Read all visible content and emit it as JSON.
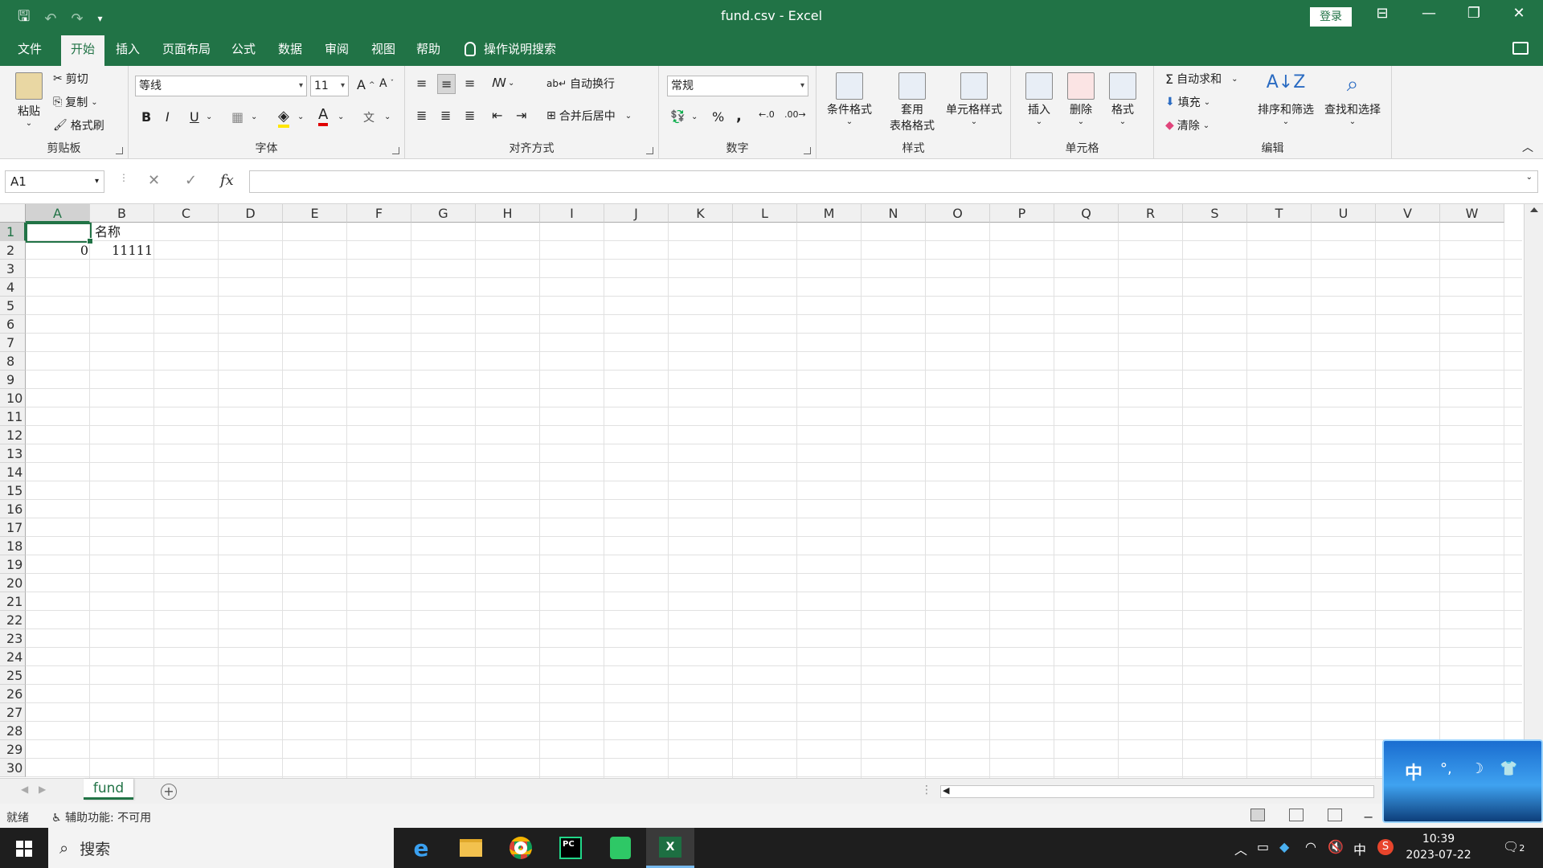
{
  "titlebar": {
    "title": "fund.csv  -  Excel",
    "login": "登录"
  },
  "menu": {
    "tabs": [
      "文件",
      "开始",
      "插入",
      "页面布局",
      "公式",
      "数据",
      "审阅",
      "视图",
      "帮助"
    ],
    "active_tab": "开始",
    "tell_me": "操作说明搜索"
  },
  "ribbon": {
    "clipboard": {
      "paste": "粘贴",
      "cut": "剪切",
      "copy": "复制",
      "format_painter": "格式刷",
      "label": "剪贴板"
    },
    "font": {
      "name": "等线",
      "size": "11",
      "label": "字体",
      "bold": "B",
      "italic": "I",
      "underline": "U"
    },
    "alignment": {
      "wrap": "自动换行",
      "merge": "合并后居中",
      "label": "对齐方式"
    },
    "number": {
      "format": "常规",
      "percent": "%",
      "comma": ",",
      "label": "数字"
    },
    "styles": {
      "conditional": "条件格式",
      "table1": "套用",
      "table2": "表格格式",
      "cell_styles": "单元格样式",
      "label": "样式"
    },
    "cells": {
      "insert": "插入",
      "delete": "删除",
      "format": "格式",
      "label": "单元格"
    },
    "editing": {
      "autosum": "自动求和",
      "fill": "填充",
      "clear": "清除",
      "sort": "排序和筛选",
      "find": "查找和选择",
      "label": "编辑"
    }
  },
  "formula_bar": {
    "name_box": "A1",
    "cancel": "✕",
    "enter": "✓",
    "fx": "fx",
    "value": ""
  },
  "sheet": {
    "columns": [
      "A",
      "B",
      "C",
      "D",
      "E",
      "F",
      "G",
      "H",
      "I",
      "J",
      "K",
      "L",
      "M",
      "N",
      "O",
      "P",
      "Q",
      "R",
      "S",
      "T",
      "U",
      "V",
      "W"
    ],
    "rows": [
      "1",
      "2",
      "3",
      "4",
      "5",
      "6",
      "7",
      "8",
      "9",
      "10",
      "11",
      "12",
      "13",
      "14",
      "15",
      "16",
      "17",
      "18",
      "19",
      "20",
      "21",
      "22",
      "23",
      "24",
      "25",
      "26",
      "27",
      "28",
      "29",
      "30"
    ],
    "cells": {
      "B1": "名称",
      "A2": "0",
      "B2": "11111"
    },
    "tab_name": "fund"
  },
  "statusbar": {
    "ready": "就绪",
    "accessibility": "辅助功能: 不可用"
  },
  "ime": {
    "mode": "中",
    "icons": [
      "°,",
      "☽",
      "👕"
    ]
  },
  "taskbar": {
    "search": "搜索",
    "tray_ime": "中",
    "time": "10:39",
    "date": "2023-07-22",
    "notifications": "2"
  }
}
